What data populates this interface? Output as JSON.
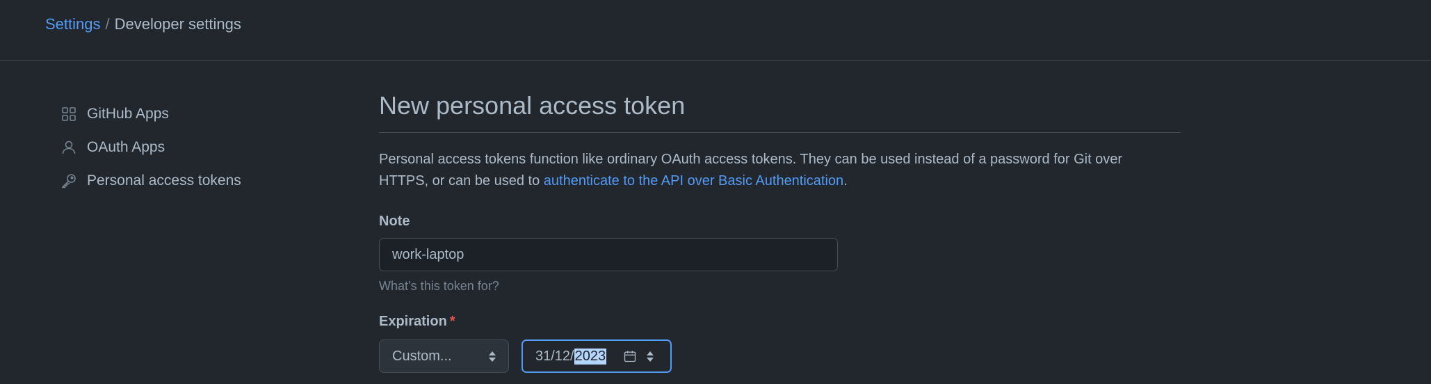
{
  "breadcrumb": {
    "root": "Settings",
    "separator": "/",
    "current": "Developer settings"
  },
  "sidebar": {
    "items": [
      {
        "label": "GitHub Apps",
        "icon": "apps-grid-icon"
      },
      {
        "label": "OAuth Apps",
        "icon": "person-icon"
      },
      {
        "label": "Personal access tokens",
        "icon": "key-icon"
      }
    ]
  },
  "main": {
    "title": "New personal access token",
    "description_prefix": "Personal access tokens function like ordinary OAuth access tokens. They can be used instead of a password for Git over HTTPS, or can be used to ",
    "description_link": "authenticate to the API over Basic Authentication",
    "description_suffix": ".",
    "note": {
      "label": "Note",
      "value": "work-laptop",
      "hint": "What’s this token for?"
    },
    "expiration": {
      "label": "Expiration",
      "required_mark": "*",
      "select_value": "Custom...",
      "date_day_month": "31/12/",
      "date_year_selected": "2023"
    }
  },
  "colors": {
    "background": "#22272e",
    "link": "#539bf5",
    "required": "#e5534b",
    "focus_border": "#539bf5",
    "selection": "#b4d5fe"
  }
}
